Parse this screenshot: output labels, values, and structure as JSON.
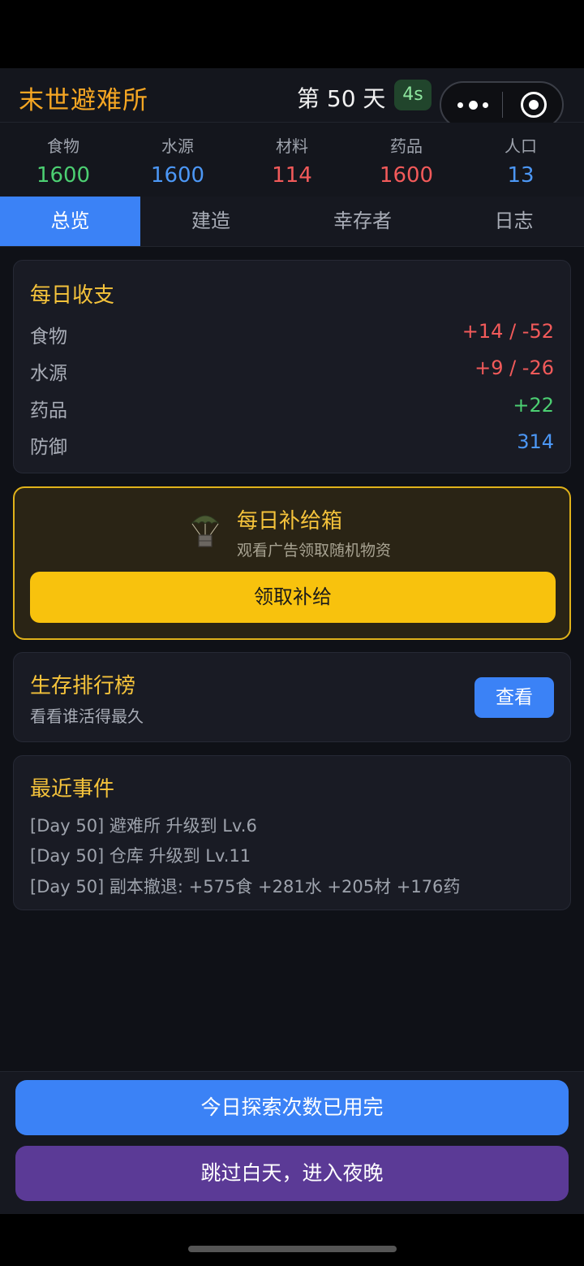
{
  "header": {
    "app_title": "末世避难所",
    "day_label": "第 50 天",
    "timer_badge": "4s"
  },
  "stats": [
    {
      "label": "食物",
      "value": "1600",
      "color": "#4ccf72"
    },
    {
      "label": "水源",
      "value": "1600",
      "color": "#4c97f5"
    },
    {
      "label": "材料",
      "value": "114",
      "color": "#f25a5a"
    },
    {
      "label": "药品",
      "value": "1600",
      "color": "#f25a5a"
    },
    {
      "label": "人口",
      "value": "13",
      "color": "#4c97f5"
    }
  ],
  "tabs": [
    {
      "label": "总览",
      "active": true
    },
    {
      "label": "建造",
      "active": false
    },
    {
      "label": "幸存者",
      "active": false
    },
    {
      "label": "日志",
      "active": false
    }
  ],
  "daily": {
    "title": "每日收支",
    "rows": [
      {
        "label": "食物",
        "value": "+14 / -52",
        "color": "#f25a5a"
      },
      {
        "label": "水源",
        "value": "+9 / -26",
        "color": "#f25a5a"
      },
      {
        "label": "药品",
        "value": "+22",
        "color": "#4ccf72"
      },
      {
        "label": "防御",
        "value": "314",
        "color": "#4c97f5"
      }
    ]
  },
  "supply": {
    "icon": "parachute-crate-icon",
    "title": "每日补给箱",
    "subtitle": "观看广告领取随机物资",
    "button": "领取补给"
  },
  "leaderboard": {
    "title": "生存排行榜",
    "subtitle": "看看谁活得最久",
    "button": "查看"
  },
  "events": {
    "title": "最近事件",
    "items": [
      "[Day 50] 避难所 升级到 Lv.6",
      "[Day 50] 仓库 升级到 Lv.11",
      "[Day 50] 副本撤退: +575食 +281水 +205材 +176药"
    ]
  },
  "actions": {
    "explore": "今日探索次数已用完",
    "skip": "跳过白天，进入夜晚"
  },
  "colors": {
    "accent_blue": "#3b82f6",
    "accent_gold": "#f8c20d",
    "accent_purple": "#5b3a96"
  }
}
